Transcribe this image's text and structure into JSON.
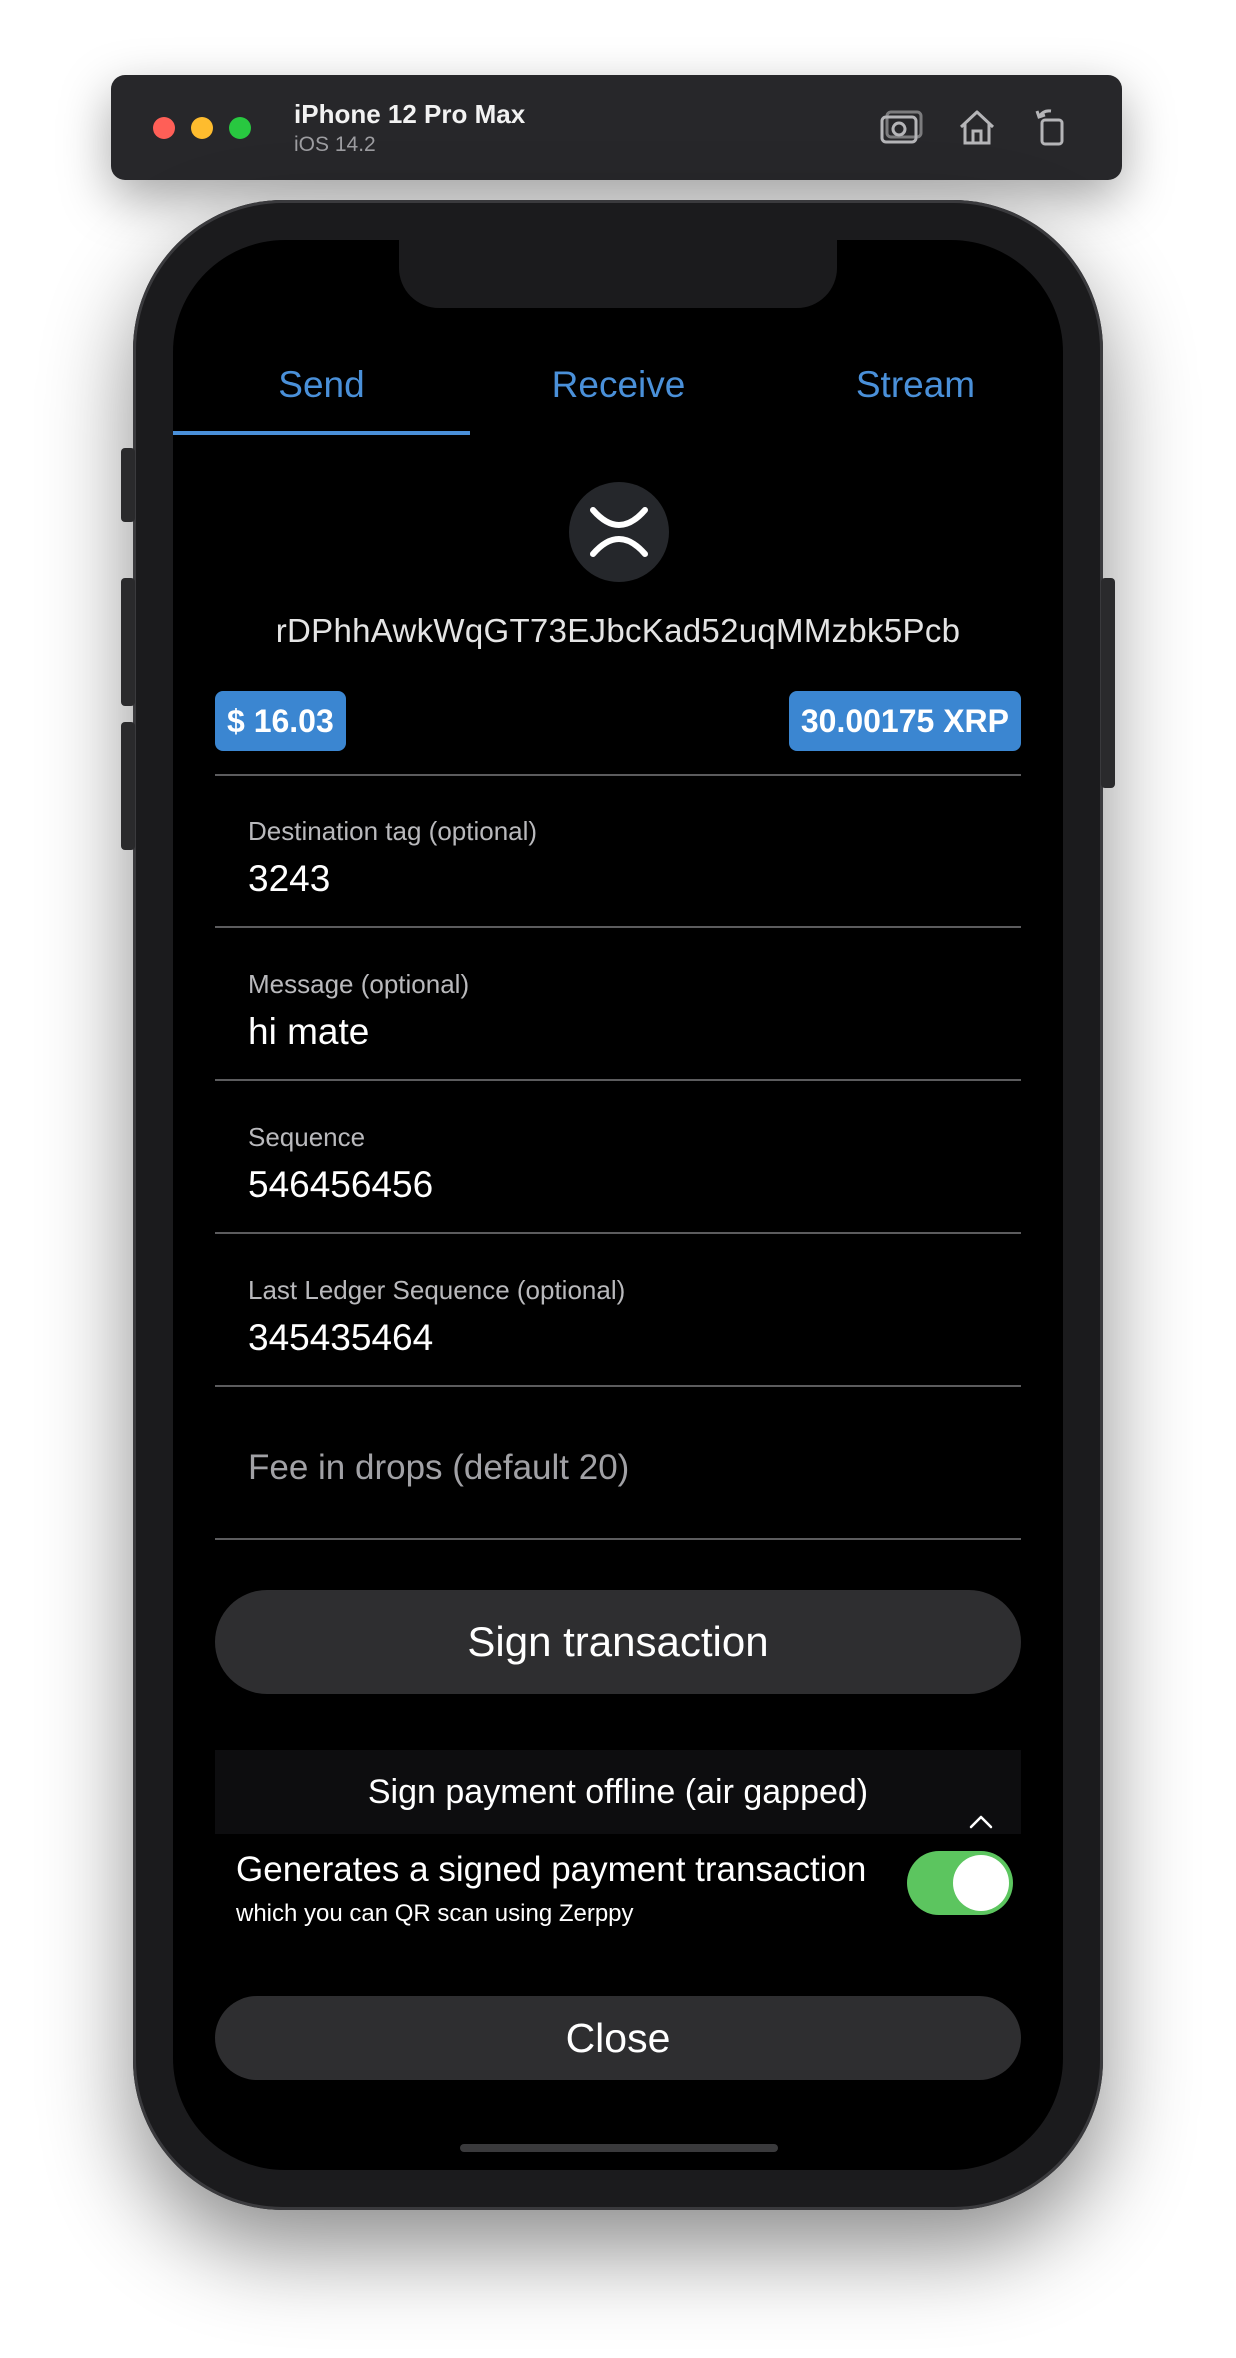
{
  "simulator": {
    "device_name": "iPhone 12 Pro Max",
    "os_version": "iOS 14.2"
  },
  "tabs": [
    {
      "label": "Send",
      "active": true
    },
    {
      "label": "Receive",
      "active": false
    },
    {
      "label": "Stream",
      "active": false
    }
  ],
  "account": {
    "logo": "xrp-logo-icon",
    "address": "rDPhhAwkWqGT73EJbcKad52uqMMzbk5Pcb",
    "usd_balance": "$ 16.03",
    "xrp_balance": "30.00175 XRP"
  },
  "form": {
    "destination_tag": {
      "label": "Destination tag (optional)",
      "value": "3243"
    },
    "message": {
      "label": "Message (optional)",
      "value": "hi mate"
    },
    "sequence": {
      "label": "Sequence",
      "value": "546456456"
    },
    "last_ledger_sequence": {
      "label": "Last Ledger Sequence (optional)",
      "value": "345435464"
    },
    "fee": {
      "placeholder": "Fee in drops (default 20)"
    }
  },
  "actions": {
    "sign_label": "Sign transaction",
    "offline_header": "Sign payment offline (air gapped)",
    "offline_title": "Generates a signed payment transaction",
    "offline_subtitle": "which you can QR scan using Zerppy",
    "offline_enabled": true,
    "close_label": "Close"
  },
  "colors": {
    "accent": "#4a90d9",
    "badge": "#3b86d1",
    "toggle_on": "#5cc55f",
    "background": "#000000"
  }
}
